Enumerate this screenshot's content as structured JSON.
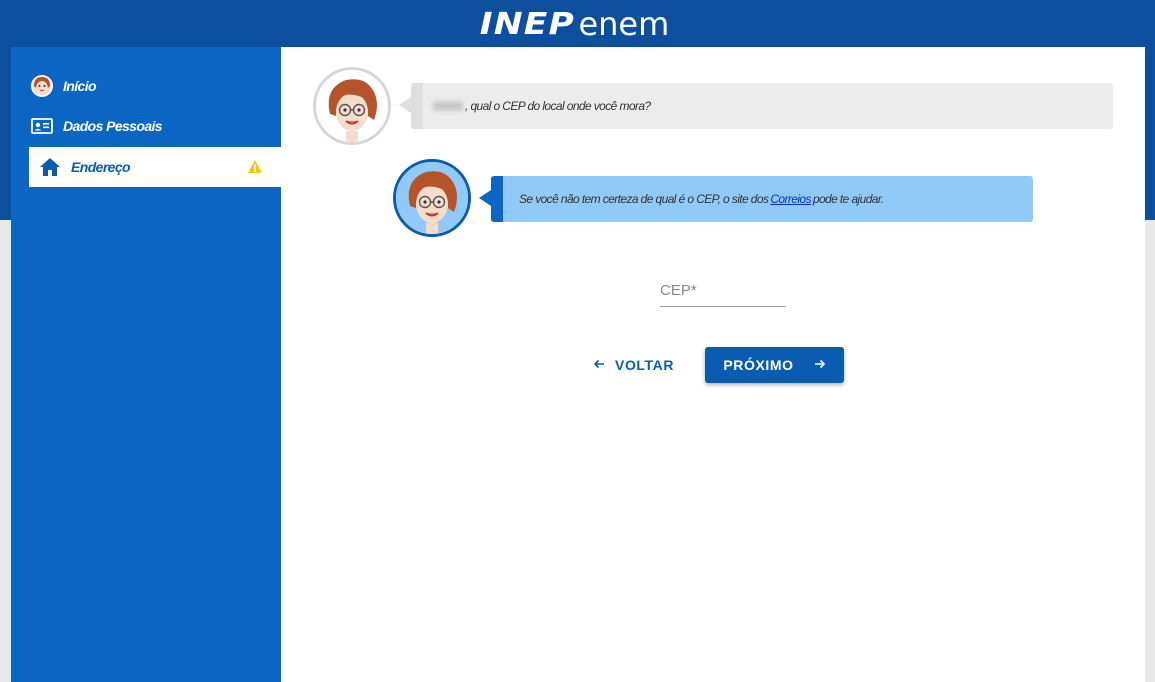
{
  "header": {
    "logo_inep": "INEP",
    "logo_enem": "enem"
  },
  "sidebar": {
    "items": [
      {
        "label": "Início",
        "icon": "avatar-icon"
      },
      {
        "label": "Dados Pessoais",
        "icon": "id-card-icon"
      },
      {
        "label": "Endereço",
        "icon": "home-icon",
        "active": true,
        "status_icon": "warning-icon"
      }
    ]
  },
  "chat": {
    "question_suffix": ", qual o CEP do local onde você mora?",
    "hint_prefix": "Se você não tem certeza de qual é o CEP, o site dos ",
    "hint_link": "Correios",
    "hint_suffix": " pode te ajudar."
  },
  "form": {
    "cep_placeholder": "CEP*",
    "cep_value": ""
  },
  "buttons": {
    "back_label": "VOLTAR",
    "next_label": "PRÓXIMO"
  },
  "colors": {
    "header_bg": "#0b4f9e",
    "sidebar_bg": "#0a66c2",
    "primary": "#0a5cb0",
    "hint_bg": "#91c9f7",
    "warning": "#f5c518"
  }
}
